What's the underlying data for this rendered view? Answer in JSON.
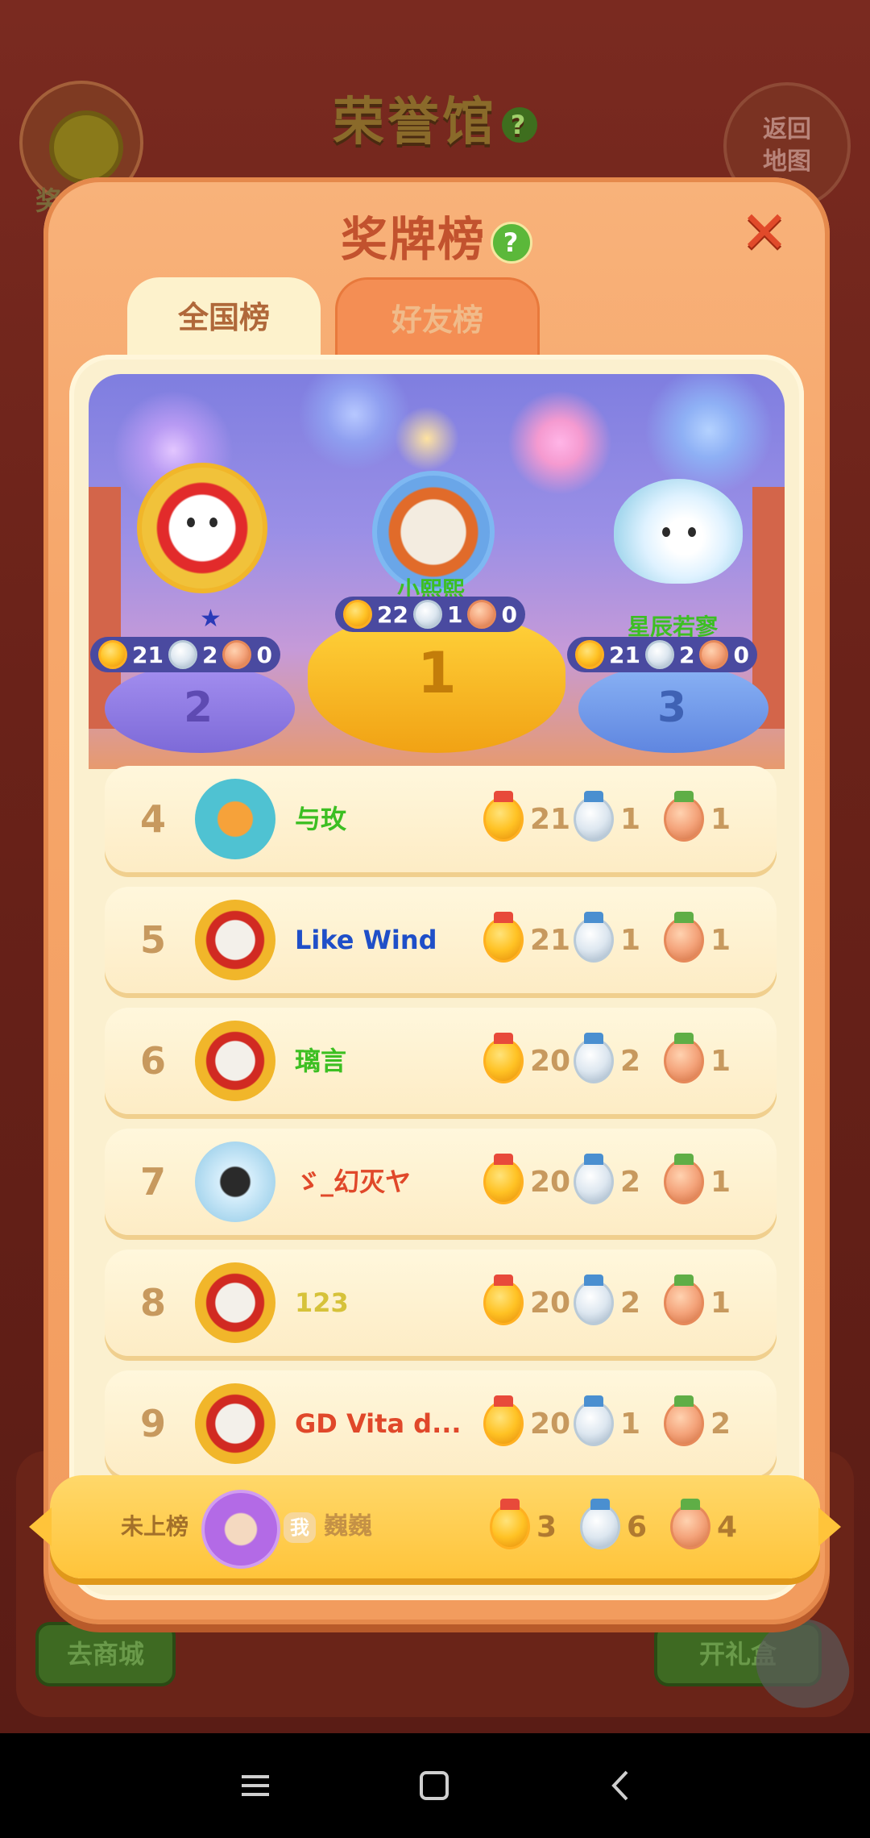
{
  "background": {
    "hall_title": "荣誉馆",
    "hall_help": "?",
    "medal_button_label": "奖",
    "back_button_label": "返回\n地图",
    "shop_button": "去商城",
    "gift_button": "开礼盒"
  },
  "modal": {
    "title": "奖牌榜",
    "help": "?",
    "close": "✕",
    "tabs": [
      {
        "label": "全国榜",
        "active": true
      },
      {
        "label": "好友榜",
        "active": false
      }
    ]
  },
  "podium": [
    {
      "rank": 1,
      "name": "小熙熙",
      "gold": 22,
      "silver": 1,
      "bronze": 0
    },
    {
      "rank": 2,
      "name": "",
      "gold": 21,
      "silver": 2,
      "bronze": 0
    },
    {
      "rank": 3,
      "name": "星辰若寥",
      "gold": 21,
      "silver": 2,
      "bronze": 0
    }
  ],
  "podium_numbers": [
    "1",
    "2",
    "3"
  ],
  "leaderboard": [
    {
      "rank": "4",
      "name": "与玫",
      "gold": "21",
      "silver": "1",
      "bronze": "1",
      "name_color": "#3cbf22",
      "avatar": "teal"
    },
    {
      "rank": "5",
      "name": "Like  Wind",
      "gold": "21",
      "silver": "1",
      "bronze": "1",
      "name_color": "#1f4fc8",
      "avatar": "red"
    },
    {
      "rank": "6",
      "name": "璃言",
      "gold": "20",
      "silver": "2",
      "bronze": "1",
      "name_color": "#3cbf22",
      "avatar": "red"
    },
    {
      "rank": "7",
      "name": "ゞ_幻灭ヤ",
      "gold": "20",
      "silver": "2",
      "bronze": "1",
      "name_color": "#e0482a",
      "avatar": "cloud"
    },
    {
      "rank": "8",
      "name": "123",
      "gold": "20",
      "silver": "2",
      "bronze": "1",
      "name_color": "#d6c23a",
      "avatar": "red"
    },
    {
      "rank": "9",
      "name": "GD Vita d...",
      "gold": "20",
      "silver": "1",
      "bronze": "2",
      "name_color": "#e0482a",
      "avatar": "red"
    }
  ],
  "me": {
    "status": "未上榜",
    "tag": "我",
    "name": "巍巍",
    "gold": "3",
    "silver": "6",
    "bronze": "4"
  },
  "colors": {
    "modal_bg": "#f6a66a",
    "title_color": "#c2522e",
    "panel_bg": "#fbf0cf",
    "me_bar": "#ffc43a"
  }
}
